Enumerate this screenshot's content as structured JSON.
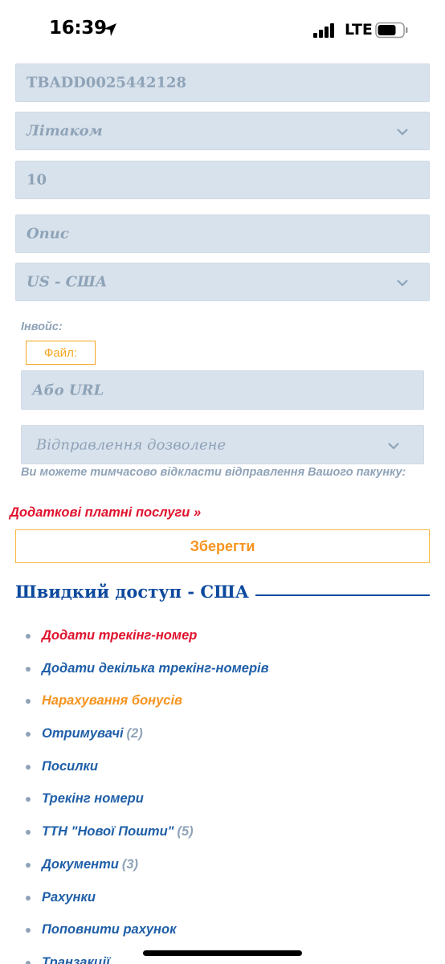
{
  "status_bar": {
    "time": "16:39",
    "network": "LTE",
    "icons": [
      "location-arrow-icon",
      "signal-icon",
      "battery-icon"
    ]
  },
  "form": {
    "tracking_number": "TBADD0025442128",
    "delivery_method": "Літаком",
    "quantity": "10",
    "description_placeholder": "Опис",
    "country": "US - США",
    "invoice_label": "Інвойс:",
    "file_button": "Файл:",
    "url_placeholder": "Або URL",
    "shipping_status": "Відправлення дозволене",
    "hint": "Ви можете тимчасово відкласти відправлення Вашого пакунку:",
    "extra_services_link": "Додаткові платні послуги »",
    "save_button": "Зберегти"
  },
  "quick_access": {
    "title": "Швидкий доступ - США",
    "items": [
      {
        "label": "Додати трекінг-номер",
        "count": "",
        "color": "#e0132e"
      },
      {
        "label": "Додати декілька трекінг-номерів",
        "count": "",
        "color": "#1f5fa8"
      },
      {
        "label": "Нарахування бонусів",
        "count": "",
        "color": "#f7931e"
      },
      {
        "label": "Отримувачі",
        "count": "(2)",
        "color": "#1f5fa8"
      },
      {
        "label": "Посилки",
        "count": "",
        "color": "#1f5fa8"
      },
      {
        "label": "Трекінг номери",
        "count": "",
        "color": "#1f5fa8"
      },
      {
        "label": "ТТН \"Нової Пошти\"",
        "count": "(5)",
        "color": "#1f5fa8"
      },
      {
        "label": "Документи",
        "count": "(3)",
        "color": "#1f5fa8"
      },
      {
        "label": "Рахунки",
        "count": "",
        "color": "#1f5fa8"
      },
      {
        "label": "Поповнити рахунок",
        "count": "",
        "color": "#1f5fa8"
      },
      {
        "label": "Транзакції",
        "count": "",
        "color": "#1f5fa8"
      }
    ]
  },
  "colors": {
    "field_bg": "#d8e2ec",
    "muted_text": "#8fa3b8",
    "accent_orange": "#f7931e",
    "link_red": "#e0132e",
    "link_blue": "#1f5fa8",
    "title_blue": "#0d4a9e"
  }
}
